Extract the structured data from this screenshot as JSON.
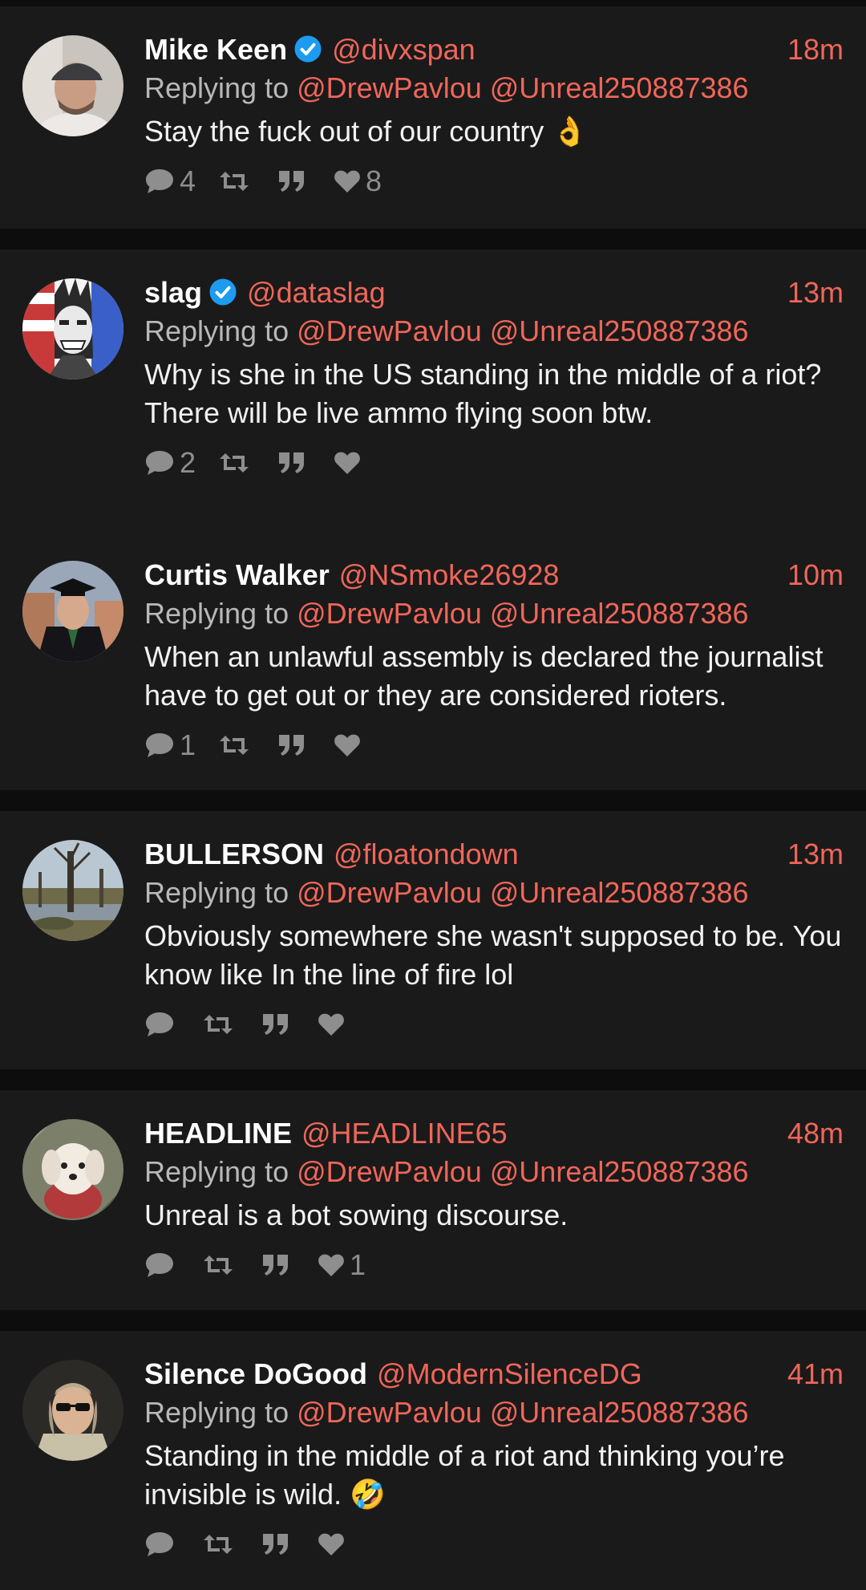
{
  "replying_label": "Replying to",
  "tweets": [
    {
      "name": "Mike Keen",
      "verified": true,
      "handle": "@divxspan",
      "time": "18m",
      "mentions": [
        "@DrewPavlou",
        "@Unreal250887386"
      ],
      "text": "Stay the fuck out of our country 👌",
      "reply_count": "4",
      "retweet_count": "",
      "quote_count": "",
      "like_count": "8",
      "avatar": "man-in-cap-avatar"
    },
    {
      "name": "slag",
      "verified": true,
      "handle": "@dataslag",
      "time": "13m",
      "mentions": [
        "@DrewPavlou",
        "@Unreal250887386"
      ],
      "text": "Why is she in the US standing in the middle of a riot? There will be live ammo flying soon btw.",
      "reply_count": "2",
      "retweet_count": "",
      "quote_count": "",
      "like_count": "",
      "avatar": "comic-hero-avatar"
    },
    {
      "name": "Curtis Walker",
      "verified": false,
      "handle": "@NSmoke26928",
      "time": "10m",
      "mentions": [
        "@DrewPavlou",
        "@Unreal250887386"
      ],
      "text": "When an unlawful assembly is declared the journalist have to get out or they are considered rioters.",
      "reply_count": "1",
      "retweet_count": "",
      "quote_count": "",
      "like_count": "",
      "avatar": "graduate-avatar"
    },
    {
      "name": "BULLERSON",
      "verified": false,
      "handle": "@floatondown",
      "time": "13m",
      "mentions": [
        "@DrewPavlou",
        "@Unreal250887386"
      ],
      "text": "Obviously somewhere she wasn't supposed to be. You know like In the line of fire lol",
      "reply_count": "",
      "retweet_count": "",
      "quote_count": "",
      "like_count": "",
      "avatar": "swamp-landscape-avatar"
    },
    {
      "name": "HEADLINE",
      "verified": false,
      "handle": "@HEADLINE65",
      "time": "48m",
      "mentions": [
        "@DrewPavlou",
        "@Unreal250887386"
      ],
      "text": "Unreal is a bot sowing discourse.",
      "reply_count": "",
      "retweet_count": "",
      "quote_count": "",
      "like_count": "1",
      "avatar": "white-dog-avatar"
    },
    {
      "name": "Silence DoGood",
      "verified": false,
      "handle": "@ModernSilenceDG",
      "time": "41m",
      "mentions": [
        "@DrewPavlou",
        "@Unreal250887386"
      ],
      "text": "Standing in the middle of a riot and thinking you’re invisible is wild. 🤣",
      "reply_count": "",
      "retweet_count": "",
      "quote_count": "",
      "like_count": "",
      "avatar": "franklin-sunglasses-avatar"
    }
  ],
  "colors": {
    "background": "#0d0d0d",
    "card": "#1a1a1a",
    "accent": "#f0665a",
    "muted": "#8e8e8e",
    "verified": "#1d9bf0"
  }
}
